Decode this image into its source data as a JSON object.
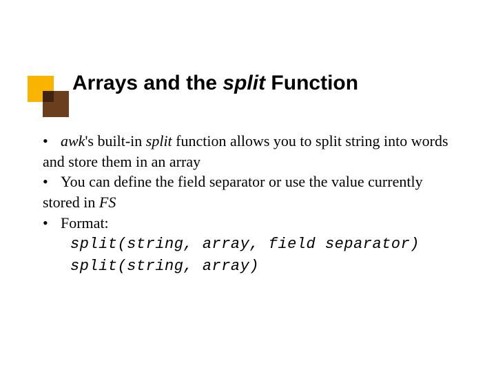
{
  "title": {
    "pre": "Arrays and the ",
    "em": "split",
    "post": " Function"
  },
  "bullets": {
    "b1": {
      "awk": "awk",
      "rest1": "'s built-in ",
      "split": "split",
      "rest2": " function allows you to split string into words and store them in an array"
    },
    "b2": {
      "text1": "You can define the field separator or use the value currently stored in ",
      "fs": "FS"
    },
    "b3": {
      "label": "Format:"
    }
  },
  "code": {
    "line1": "split(string, array, field separator)",
    "line2": "split(string, array)"
  },
  "glyph": {
    "dot": "•"
  }
}
